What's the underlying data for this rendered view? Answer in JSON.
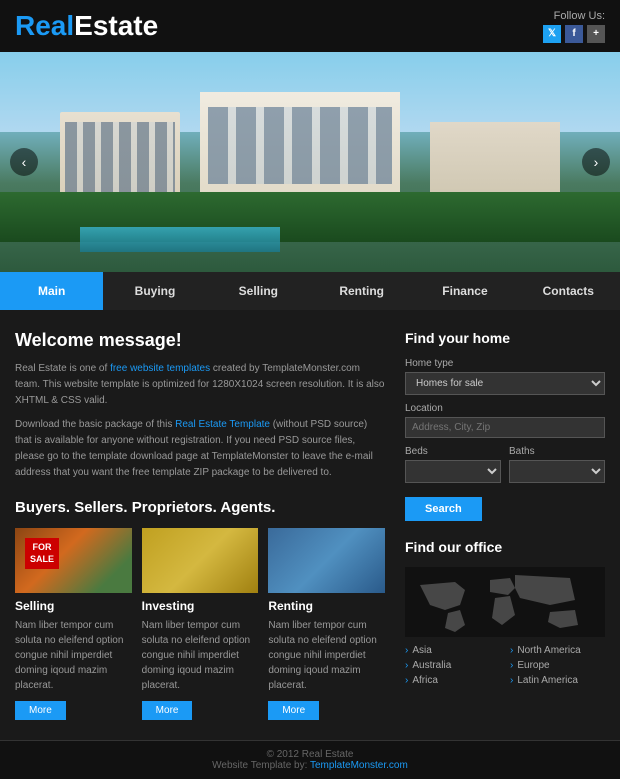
{
  "header": {
    "logo_real": "Real",
    "logo_estate": "Estate",
    "follow_label": "Follow Us:"
  },
  "social": [
    {
      "icon": "𝕏",
      "name": "twitter",
      "label": "twitter-icon"
    },
    {
      "icon": "f",
      "name": "facebook",
      "label": "facebook-icon"
    },
    {
      "icon": "+",
      "name": "googleplus",
      "label": "googleplus-icon"
    }
  ],
  "nav": {
    "items": [
      {
        "label": "Main",
        "active": true
      },
      {
        "label": "Buying",
        "active": false
      },
      {
        "label": "Selling",
        "active": false
      },
      {
        "label": "Renting",
        "active": false
      },
      {
        "label": "Finance",
        "active": false
      },
      {
        "label": "Contacts",
        "active": false
      }
    ]
  },
  "slider": {
    "prev": "‹",
    "next": "›"
  },
  "welcome": {
    "title": "Welcome message!",
    "para1": "Real Estate is one of free website templates created by TemplateMonster.com team. This website template is optimized for 1280X1024 screen resolution. It is also XHTML & CSS valid.",
    "para2": "Download the basic package of this Real Estate Template (without PSD source) that is available for anyone without registration. If you need PSD source files, please go to the template download page at TemplateMonster to leave the e-mail address that you want the free template ZIP package to be delivered to.",
    "link1": "free website templates",
    "link2": "Real Estate Template",
    "section_title": "Buyers. Sellers. Proprietors. Agents."
  },
  "cards": [
    {
      "label": "Selling",
      "type": "selling",
      "text": "Nam liber tempor cum soluta no eleifend option congue nihil imperdiet doming iqoud mazim placerat.",
      "btn": "More"
    },
    {
      "label": "Investing",
      "type": "investing",
      "text": "Nam liber tempor cum soluta no eleifend option congue nihil imperdiet doming iqoud mazim placerat.",
      "btn": "More"
    },
    {
      "label": "Renting",
      "type": "renting",
      "text": "Nam liber tempor cum soluta no eleifend option congue nihil imperdiet doming iqoud mazim placerat.",
      "btn": "More"
    }
  ],
  "sidebar": {
    "find_title": "Find your home",
    "home_type_label": "Home type",
    "home_type_placeholder": "Homes for sale",
    "location_label": "Location",
    "location_placeholder": "Address, City, Zip",
    "beds_label": "Beds",
    "beds_placeholder": "",
    "baths_label": "Baths",
    "baths_placeholder": "",
    "search_btn": "Search",
    "office_title": "Find our office",
    "regions_col1": [
      "Asia",
      "Australia",
      "Africa"
    ],
    "regions_col2": [
      "North America",
      "Europe",
      "Latin America"
    ]
  },
  "footer": {
    "copyright": "© 2012 Real Estate",
    "credit": "Website Template by: TemplateMonster.com"
  }
}
